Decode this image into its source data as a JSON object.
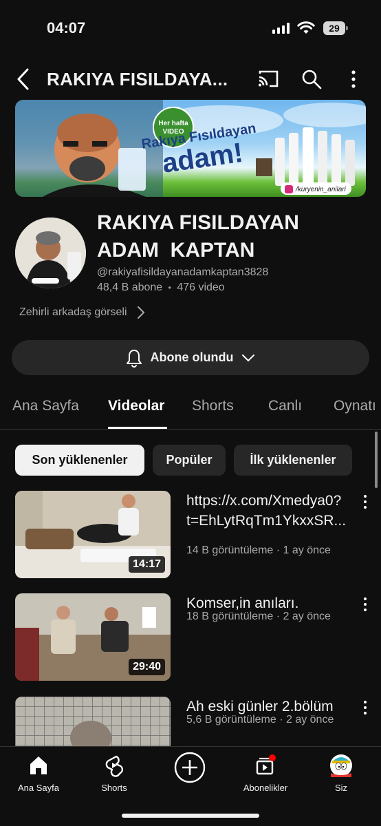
{
  "status_bar": {
    "time": "04:07",
    "battery": "29"
  },
  "header": {
    "title": "RAKIYA FISILDAYA..."
  },
  "banner": {
    "badge_line1": "Her hafta",
    "badge_line2": "VIDEO",
    "headline_line1": "Rakıya Fısıldayan",
    "headline_line2": "adam!",
    "social": "/kuryenin_anilari"
  },
  "channel": {
    "name_line1": "RAKIYA FISILDAYAN",
    "name_line2": "ADAM  KAPTAN",
    "handle": "@rakiyafisildayanadamkaptan3828",
    "subscribers": "48,4 B abone",
    "separator": "•",
    "video_count": "476 video",
    "link": "Zehirli arkadaş görseli"
  },
  "subscribe": {
    "label": "Abone olundu"
  },
  "tabs": [
    "Ana Sayfa",
    "Videolar",
    "Shorts",
    "Canlı",
    "Oynatı"
  ],
  "chips": [
    "Son yüklenenler",
    "Popüler",
    "İlk yüklenenler"
  ],
  "videos": [
    {
      "title": "https://x.com/Xmedya0?t=EhLytRqTm1YkxxSR...",
      "views": "14 B görüntüleme",
      "age": "1 ay önce",
      "duration": "14:17"
    },
    {
      "title": "Komser,in anıları.",
      "views": "18 B görüntüleme",
      "age": "2 ay önce",
      "duration": "29:40"
    },
    {
      "title": "Ah eski günler 2.bölüm",
      "views": "5,6 B görüntüleme",
      "age": "2 ay önce",
      "duration": ""
    }
  ],
  "meta_separator": " · ",
  "bottom_nav": [
    {
      "label": "Ana Sayfa",
      "icon": "home-icon"
    },
    {
      "label": "Shorts",
      "icon": "shorts-icon"
    },
    {
      "label": "",
      "icon": "create-icon"
    },
    {
      "label": "Abonelikler",
      "icon": "subscriptions-icon"
    },
    {
      "label": "Siz",
      "icon": "avatar-icon"
    }
  ],
  "colors": {
    "background": "#0f0f0f",
    "surface": "#272727",
    "text": "#f1f1f1",
    "muted": "#aaaaaa",
    "notification": "#ff0000"
  }
}
